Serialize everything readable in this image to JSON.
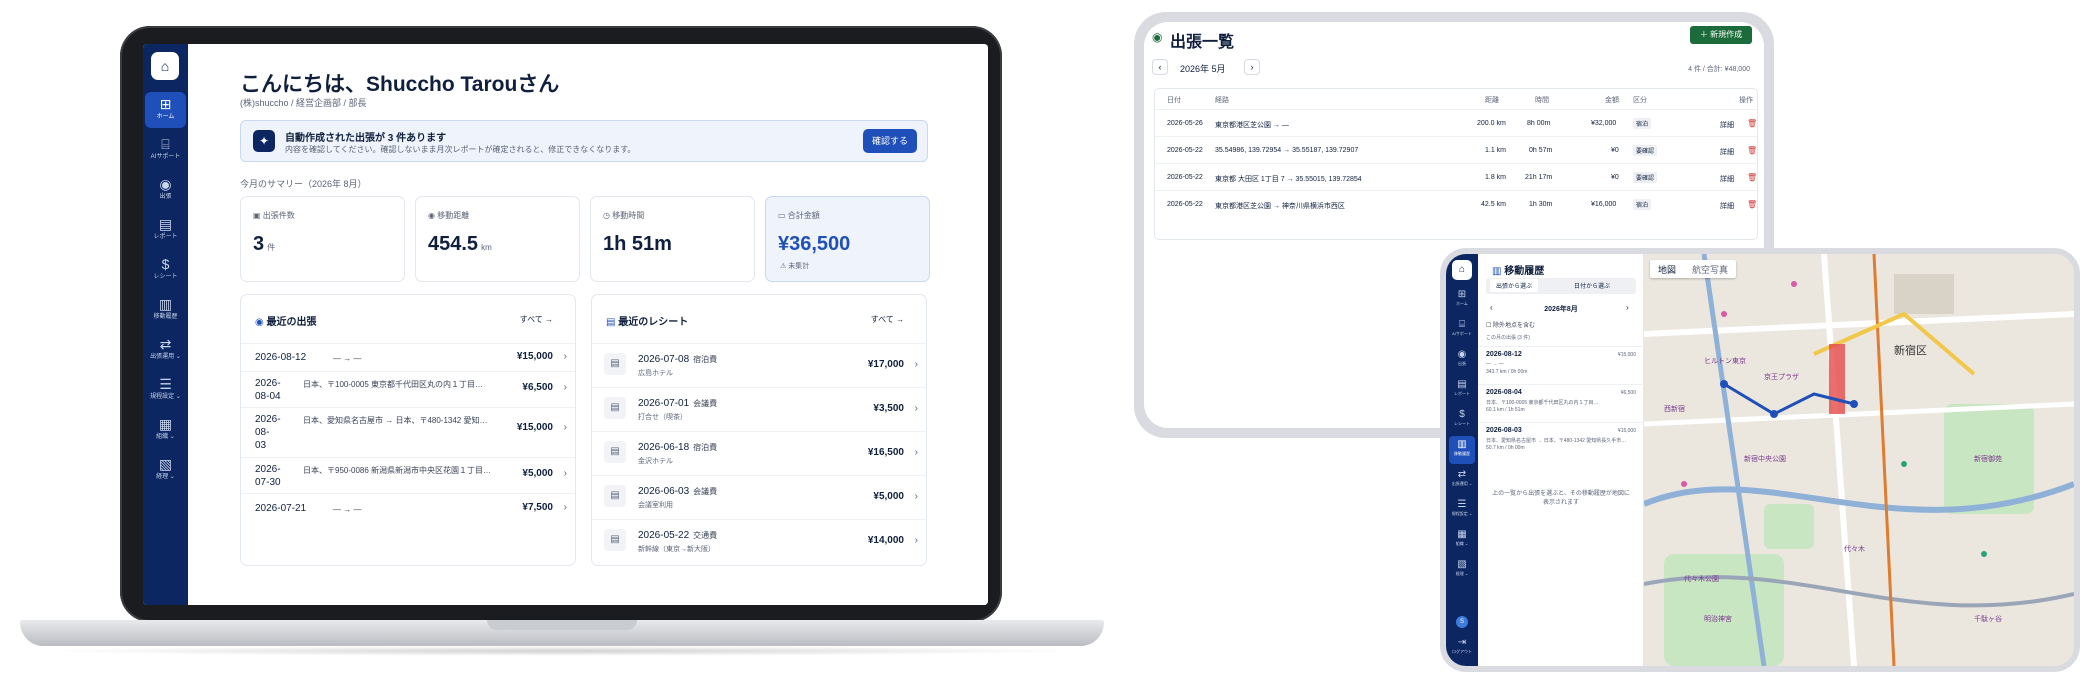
{
  "laptop": {
    "sidebar": {
      "items": [
        {
          "label": "ホーム",
          "icon": "grid-icon"
        },
        {
          "label": "AIサポート",
          "icon": "robot-icon"
        },
        {
          "label": "出張",
          "icon": "pin-icon"
        },
        {
          "label": "レポート",
          "icon": "document-icon"
        },
        {
          "label": "レシート",
          "icon": "receipt-icon"
        },
        {
          "label": "移動履歴",
          "icon": "map-icon"
        },
        {
          "label": "出張運用 ⌄",
          "icon": "route-icon"
        },
        {
          "label": "規程設定 ⌄",
          "icon": "sliders-icon"
        },
        {
          "label": "組織 ⌄",
          "icon": "building-icon"
        },
        {
          "label": "経理 ⌄",
          "icon": "ledger-icon"
        }
      ]
    },
    "greeting": "こんにちは、Shuccho Tarouさん",
    "org": "(株)shuccho / 経営企画部 / 部長",
    "banner": {
      "title": "自動作成された出張が 3 件あります",
      "desc": "内容を確認してください。確認しないまま月次レポートが確定されると、修正できなくなります。",
      "button": "確認する"
    },
    "summary_title": "今月のサマリー（2026年 8月）",
    "stats": [
      {
        "label": "出張件数",
        "value": "3",
        "unit": "件"
      },
      {
        "label": "移動距離",
        "value": "454.5",
        "unit": "km"
      },
      {
        "label": "移動時間",
        "value": "1h 51m",
        "unit": ""
      },
      {
        "label": "合計金額",
        "value": "¥36,500",
        "unit": "",
        "note": "⚠ 未集計"
      }
    ],
    "recent_trips": {
      "title": "最近の出張",
      "all": "すべて →",
      "rows": [
        {
          "date": "2026-08-12",
          "route": "— → —",
          "price": "¥15,000"
        },
        {
          "date": "2026-\n08-04",
          "route": "日本、〒100-0005 東京都千代田区丸の内１丁目…",
          "price": "¥6,500"
        },
        {
          "date": "2026-\n08-\n03",
          "route": "日本、愛知県名古屋市 → 日本、〒480-1342 愛知…",
          "price": "¥15,000"
        },
        {
          "date": "2026-\n07-30",
          "route": "日本、〒950-0086 新潟県新潟市中央区花園１丁目…",
          "price": "¥5,000"
        },
        {
          "date": "2026-07-21",
          "route": "— → —",
          "price": "¥7,500"
        }
      ]
    },
    "recent_receipts": {
      "title": "最近のレシート",
      "all": "すべて →",
      "rows": [
        {
          "date": "2026-07-08",
          "cat": "宿泊費",
          "sub": "広島ホテル",
          "price": "¥17,000"
        },
        {
          "date": "2026-07-01",
          "cat": "会議費",
          "sub": "打合せ（喫茶）",
          "price": "¥3,500"
        },
        {
          "date": "2026-06-18",
          "cat": "宿泊費",
          "sub": "金沢ホテル",
          "price": "¥16,500"
        },
        {
          "date": "2026-06-03",
          "cat": "会議費",
          "sub": "会議室利用",
          "price": "¥5,000"
        },
        {
          "date": "2026-05-22",
          "cat": "交通費",
          "sub": "新幹線（東京→新大阪）",
          "price": "¥14,000"
        }
      ]
    }
  },
  "trip_list": {
    "title": "出張一覧",
    "new_button": "＋ 新規作成",
    "month": "2026年 5月",
    "summary": "4 件 / 合計: ¥48,000",
    "headers": [
      "日付",
      "経路",
      "距離",
      "時間",
      "金額",
      "区分",
      "操作"
    ],
    "rows": [
      {
        "date": "2026-05-26",
        "route": "東京都港区芝公園 → —",
        "dist": "200.0 km",
        "time": "8h 00m",
        "price": "¥32,000",
        "tag": "宿泊",
        "op": "詳細"
      },
      {
        "date": "2026-05-22",
        "route": "35.54986, 139.72954 → 35.55187, 139.72907",
        "dist": "1.1 km",
        "time": "0h 57m",
        "price": "¥0",
        "tag": "要確認",
        "op": "詳細"
      },
      {
        "date": "2026-05-22",
        "route": "東京都 大田区 1丁目 7 → 35.55015, 139.72854",
        "dist": "1.8 km",
        "time": "21h 17m",
        "price": "¥0",
        "tag": "要確認",
        "op": "詳細"
      },
      {
        "date": "2026-05-22",
        "route": "東京都港区芝公園 → 神奈川県横浜市西区",
        "dist": "42.5 km",
        "time": "1h 30m",
        "price": "¥16,000",
        "tag": "宿泊",
        "op": "詳細"
      }
    ]
  },
  "history": {
    "sidebar": [
      {
        "label": "ホーム",
        "icon": "grid-icon"
      },
      {
        "label": "AIサポート",
        "icon": "robot-icon"
      },
      {
        "label": "出張",
        "icon": "pin-icon"
      },
      {
        "label": "レポート",
        "icon": "document-icon"
      },
      {
        "label": "レシート",
        "icon": "receipt-icon"
      },
      {
        "label": "移動履歴",
        "icon": "map-icon"
      },
      {
        "label": "出張運用 ⌄",
        "icon": "route-icon"
      },
      {
        "label": "規程設定 ⌄",
        "icon": "sliders-icon"
      },
      {
        "label": "組織 ⌄",
        "icon": "building-icon"
      },
      {
        "label": "経理 ⌄",
        "icon": "ledger-icon"
      }
    ],
    "logout": "ログアウト",
    "avatar": "S",
    "title": "移動履歴",
    "seg_left": "出張から選ぶ",
    "seg_right": "日付から選ぶ",
    "month": "2026年8月",
    "check": "除外地点を含む",
    "count": "この月の出張 (3 件)",
    "items": [
      {
        "date": "2026-08-12",
        "price": "¥15,000",
        "route": "— → —",
        "stats": "343.7 km / 0h 00m"
      },
      {
        "date": "2026-08-04",
        "price": "¥6,500",
        "route": "日本、〒100-0005 東京都千代田区丸の内１丁目…",
        "stats": "60.1 km / 1h 51m"
      },
      {
        "date": "2026-08-03",
        "price": "¥15,000",
        "route": "日本、愛知県名古屋市 → 日本、〒480-1342 愛知県長久手市…",
        "stats": "50.7 km / 0h 00m"
      }
    ],
    "hint": "上の一覧から出張を選ぶと、その移動履歴が地図に表示されます",
    "map_tabs": [
      "地図",
      "航空写真"
    ],
    "map_labels": [
      "新宿区",
      "ヒルトン東京",
      "新宿御苑",
      "代々木",
      "明治神宮",
      "京王プラザ",
      "新宿中央公園",
      "西新宿",
      "代々木公園",
      "千駄ヶ谷"
    ]
  }
}
